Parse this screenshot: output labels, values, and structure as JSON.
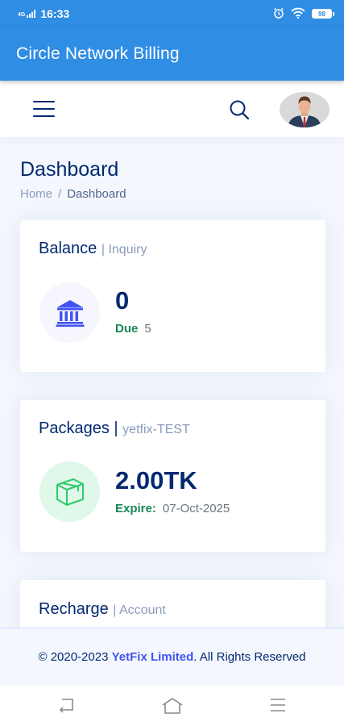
{
  "status_bar": {
    "network": "4G",
    "time": "16:33",
    "battery": "98"
  },
  "app_bar": {
    "title": "Circle Network Billing"
  },
  "header": {
    "menu_icon": "hamburger-icon",
    "search_icon": "search-icon",
    "avatar_icon": "user-avatar"
  },
  "page": {
    "title": "Dashboard",
    "breadcrumb": [
      {
        "label": "Home"
      },
      {
        "label": "Dashboard"
      }
    ],
    "breadcrumb_separator": "/"
  },
  "cards": {
    "balance": {
      "title": "Balance",
      "subtitle": "| Inquiry",
      "icon": "bank-icon",
      "value": "0",
      "meta_key": "Due",
      "meta_value": "5"
    },
    "packages": {
      "title": "Packages",
      "separator": "|",
      "subtitle": "yetfix-TEST",
      "icon": "box-icon",
      "value": "2.00TK",
      "meta_key": "Expire:",
      "meta_value": "07-Oct-2025"
    },
    "recharge": {
      "title": "Recharge",
      "subtitle": "| Account"
    }
  },
  "footer": {
    "prefix": "© 2020-2023",
    "brand": "YetFix Limited",
    "suffix": ". All Rights Reserved"
  },
  "android_nav": {
    "back": "back-icon",
    "home": "home-icon",
    "menu": "recents-icon"
  },
  "colors": {
    "primary": "#2f8de4",
    "navy": "#012970",
    "green": "#198754",
    "brand_blue": "#4154f1"
  }
}
